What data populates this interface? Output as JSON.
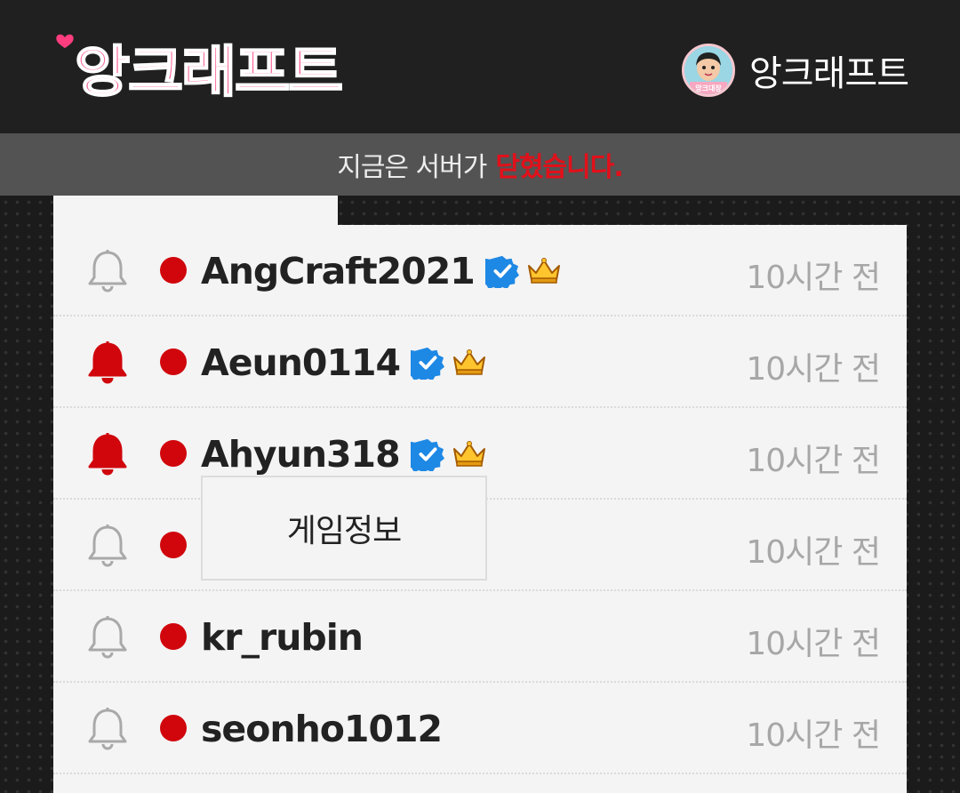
{
  "header": {
    "logo_text": "앙크래프트",
    "profile_name": "앙크래프트",
    "avatar_caption": "앙크대장"
  },
  "notice": {
    "prefix": "지금은 서버가",
    "emphasis": "닫혔습니다."
  },
  "players": [
    {
      "name": "AngCraft2021",
      "time": "10시간 전",
      "bell": "outline",
      "verified": true,
      "crown": true
    },
    {
      "name": "Aeun0114",
      "time": "10시간 전",
      "bell": "filled-red",
      "verified": true,
      "crown": true
    },
    {
      "name": "Ahyun318",
      "time": "10시간 전",
      "bell": "filled-red",
      "verified": true,
      "crown": true
    },
    {
      "name": "",
      "time": "10시간 전",
      "bell": "outline",
      "verified": false,
      "crown": false
    },
    {
      "name": "kr_rubin",
      "time": "10시간 전",
      "bell": "outline",
      "verified": false,
      "crown": false
    },
    {
      "name": "seonho1012",
      "time": "10시간 전",
      "bell": "outline",
      "verified": false,
      "crown": false
    }
  ],
  "popup": {
    "label": "게임정보"
  },
  "colors": {
    "online_dot": "#d0060c",
    "bell_active": "#d0060c",
    "bell_inactive": "#a9a9a9",
    "verified_badge": "#1e88e5",
    "notice_emphasis": "#e1101a"
  }
}
